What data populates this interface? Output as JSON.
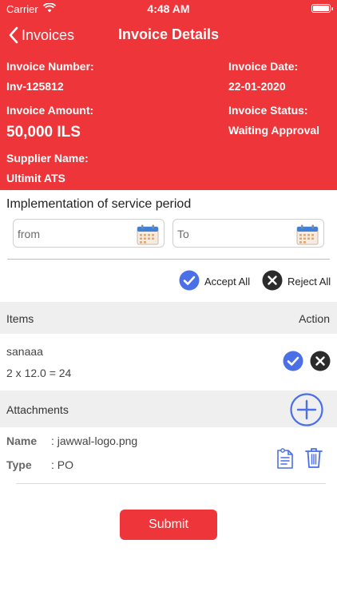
{
  "status_bar": {
    "carrier": "Carrier",
    "time": "4:48 AM"
  },
  "nav": {
    "back_label": "Invoices",
    "title": "Invoice Details"
  },
  "invoice": {
    "number_label": "Invoice Number:",
    "number": "Inv-125812",
    "date_label": "Invoice Date:",
    "date": "22-01-2020",
    "amount_label": "Invoice Amount:",
    "amount": "50,000 ILS",
    "status_label": "Invoice Status:",
    "status": "Waiting Approval",
    "supplier_label": "Supplier Name:",
    "supplier": "Ultimit ATS"
  },
  "service_period": {
    "title": "Implementation of service period",
    "from_placeholder": "from",
    "to_placeholder": "To"
  },
  "bulk_actions": {
    "accept_all": "Accept All",
    "reject_all": "Reject All"
  },
  "items": {
    "header_label": "Items",
    "action_label": "Action",
    "rows": [
      {
        "name": "sanaaa",
        "calc": "2 x 12.0 = 24"
      }
    ]
  },
  "attachments": {
    "header_label": "Attachments",
    "rows": [
      {
        "name_key": "Name",
        "name_value": ": jawwal-logo.png",
        "type_key": "Type",
        "type_value": ": PO"
      }
    ]
  },
  "submit_label": "Submit",
  "colors": {
    "brand_red": "#ee3539",
    "accept_blue": "#4a6fe6",
    "reject_dark": "#2b2b2b"
  },
  "icons": [
    "wifi-icon",
    "battery-icon",
    "chevron-left-icon",
    "calendar-icon",
    "check-circle-icon",
    "close-circle-icon",
    "add-circle-icon",
    "document-icon",
    "trash-icon"
  ]
}
